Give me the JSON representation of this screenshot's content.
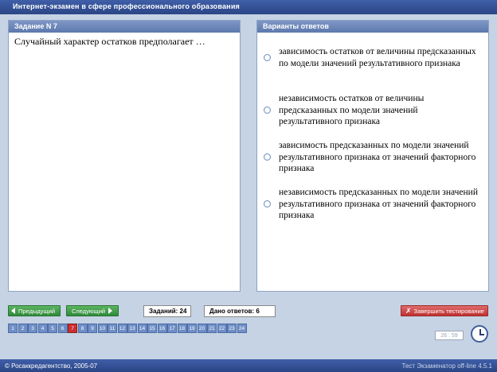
{
  "window": {
    "title": "Интернет-экзамен в сфере профессионального образования"
  },
  "question_panel": {
    "header": "Задание N 7",
    "text": "Случайный характер остатков предполагает …"
  },
  "answers_panel": {
    "header": "Варианты ответов",
    "options": [
      {
        "label": "зависимость остатков от величины предсказанных по модели значений результативного признака",
        "selected": false
      },
      {
        "label": "независимость остатков от величины предсказанных по модели значений результативного признака",
        "selected": false
      },
      {
        "label": "зависимость предсказанных по модели значений результативного признака от значений факторного признака",
        "selected": false
      },
      {
        "label": "независимость предсказанных по модели значений результативного признака от значений факторного признака",
        "selected": false
      }
    ]
  },
  "toolbar": {
    "prev_label": "Предыдущий",
    "next_label": "Следующий",
    "tasks_count": "Заданий: 24",
    "answers_count": "Дано ответов: 6",
    "finish_label": "Завершить тестирование"
  },
  "pager": {
    "pages": [
      "1",
      "2",
      "3",
      "4",
      "5",
      "6",
      "7",
      "8",
      "9",
      "10",
      "11",
      "12",
      "13",
      "14",
      "15",
      "16",
      "17",
      "18",
      "19",
      "20",
      "21",
      "22",
      "23",
      "24"
    ],
    "current": "7"
  },
  "timer": {
    "text": "26 : 59"
  },
  "footer": {
    "copyright": "© Росаккредагентство, 2005-07",
    "version": "Тест Экзаменатор off-line 4.5.1"
  },
  "colors": {
    "accent": "#2b4585",
    "nav_button": "#3a9a44",
    "finish_button": "#c83a3a",
    "current_page": "#cc2e2e"
  }
}
